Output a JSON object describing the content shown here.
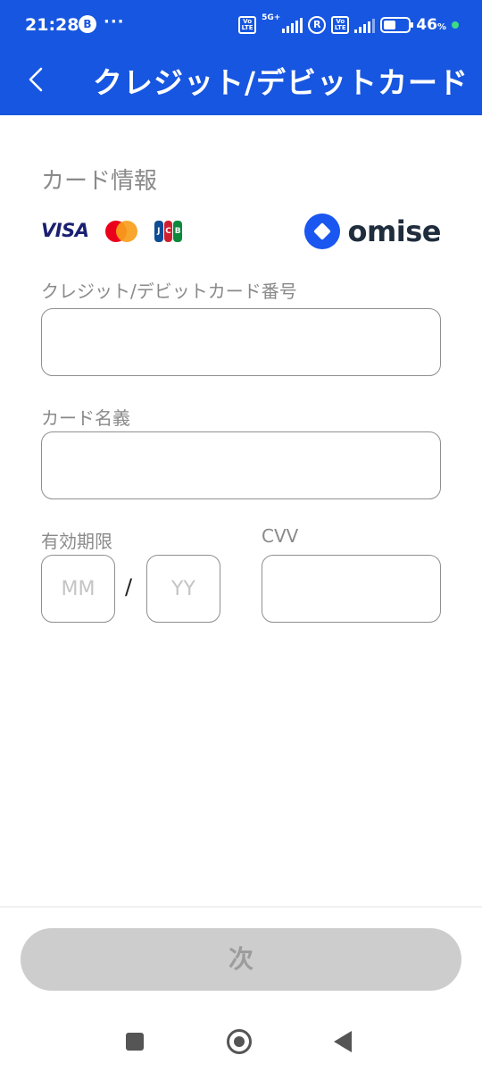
{
  "status_bar": {
    "time": "21:28",
    "notif_badge": "B",
    "overflow": "···",
    "lte_label": "Vo LTE",
    "network": "5G+",
    "roaming": "R",
    "battery_pct": "46",
    "battery_unit": "%"
  },
  "app_bar": {
    "back_icon": "chevron-left-icon",
    "title": "クレジット/デビットカード"
  },
  "form": {
    "section_title": "カード情報",
    "brands": {
      "visa": "VISA",
      "jcb": [
        "J",
        "C",
        "B"
      ],
      "omise": "omise"
    },
    "card_number": {
      "label": "クレジット/デビットカード番号",
      "value": "",
      "placeholder": ""
    },
    "card_name": {
      "label": "カード名義",
      "value": "",
      "placeholder": ""
    },
    "expiry": {
      "label": "有効期限",
      "month_placeholder": "MM",
      "year_placeholder": "YY",
      "separator": "/"
    },
    "cvv": {
      "label": "CVV",
      "value": "",
      "placeholder": ""
    }
  },
  "actions": {
    "next_label": "次"
  },
  "colors": {
    "primary": "#1756e0",
    "button_disabled": "#cdcdcd",
    "label_gray": "#8a8a8a"
  }
}
